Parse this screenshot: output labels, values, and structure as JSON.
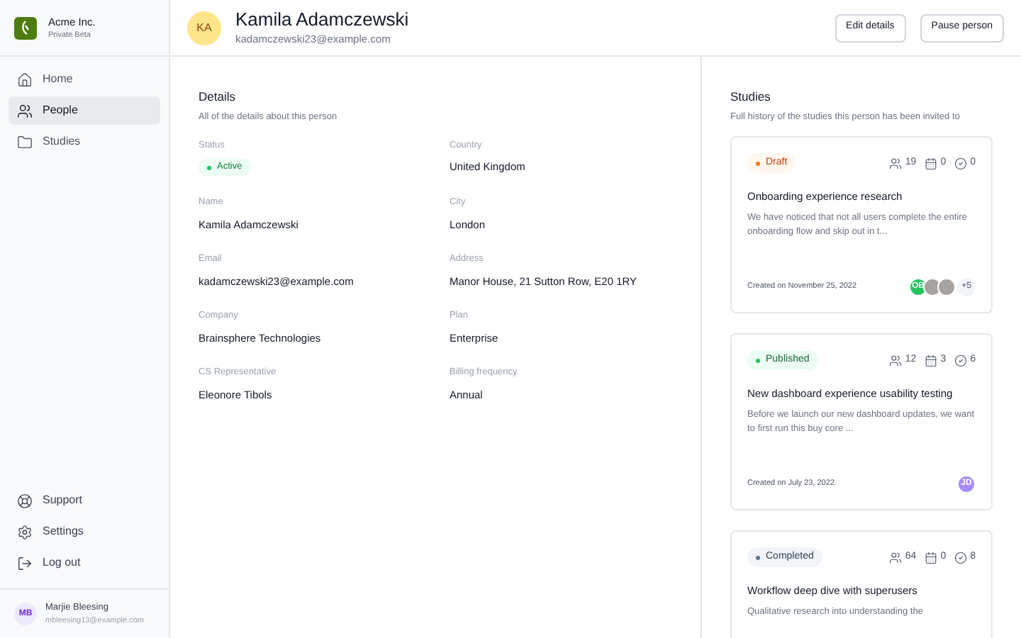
{
  "org": {
    "name": "Acme Inc.",
    "subtitle": "Private Beta"
  },
  "nav": [
    {
      "label": "Home",
      "selected": false
    },
    {
      "label": "People",
      "selected": true
    },
    {
      "label": "Studies",
      "selected": false
    }
  ],
  "footer_nav": [
    {
      "label": "Support"
    },
    {
      "label": "Settings"
    },
    {
      "label": "Log out"
    }
  ],
  "user": {
    "initials": "MB",
    "name": "Marjie Bleesing",
    "email": "mbleesing13@example.com"
  },
  "person": {
    "initials": "KA",
    "name": "Kamila Adamczewski",
    "email": "kadamczewski23@example.com"
  },
  "actions": [
    "Edit details",
    "Pause person"
  ],
  "details": {
    "title": "Details",
    "subtitle": "All of the details about this person",
    "fields": [
      {
        "label": "Status",
        "kind": "badge",
        "value": "Active"
      },
      {
        "label": "Country",
        "kind": "text",
        "value": "United Kingdom"
      },
      {
        "label": "Name",
        "kind": "text",
        "value": "Kamila Adamczewski"
      },
      {
        "label": "City",
        "kind": "text",
        "value": "London"
      },
      {
        "label": "Email",
        "kind": "text",
        "value": "kadamczewski23@example.com"
      },
      {
        "label": "Address",
        "kind": "text",
        "value": "Manor House, 21 Sutton Row, E20 1RY"
      },
      {
        "label": "Company",
        "kind": "text",
        "value": "Brainsphere Technologies"
      },
      {
        "label": "Plan",
        "kind": "text",
        "value": "Enterprise"
      },
      {
        "label": "CS Representative",
        "kind": "text",
        "value": "Eleonore Tibols"
      },
      {
        "label": "Billing frequency",
        "kind": "text",
        "value": "Annual"
      }
    ]
  },
  "studies": {
    "title": "Studies",
    "subtitle": "Full history of the studies this person has been invited to",
    "items": [
      {
        "status": "Draft",
        "kind": "draft",
        "participants": "19",
        "sessions": "0",
        "completed": "0",
        "title": "Onboarding experience research",
        "description": "We have noticed that not all users complete the entire onboarding flow and skip out in t...",
        "created": "Created on November 25, 2022",
        "avatars": [
          {
            "kind": "initials",
            "text": "OB",
            "color": "#22c55e"
          },
          {
            "kind": "photo"
          },
          {
            "kind": "photo"
          },
          {
            "kind": "count",
            "text": "+5"
          }
        ]
      },
      {
        "status": "Published",
        "kind": "published",
        "participants": "12",
        "sessions": "3",
        "completed": "6",
        "title": "New dashboard experience usability testing",
        "description": "Before we launch our new dashboard updates, we want to first run this buy core ...",
        "created": "Created on July 23, 2022",
        "avatars": [
          {
            "kind": "initials",
            "text": "JD",
            "color": "#a78bfa"
          }
        ]
      },
      {
        "status": "Completed",
        "kind": "completed",
        "participants": "64",
        "sessions": "0",
        "completed": "8",
        "title": "Workflow deep dive with superusers",
        "description": "Qualitative research into understanding the"
      }
    ]
  }
}
